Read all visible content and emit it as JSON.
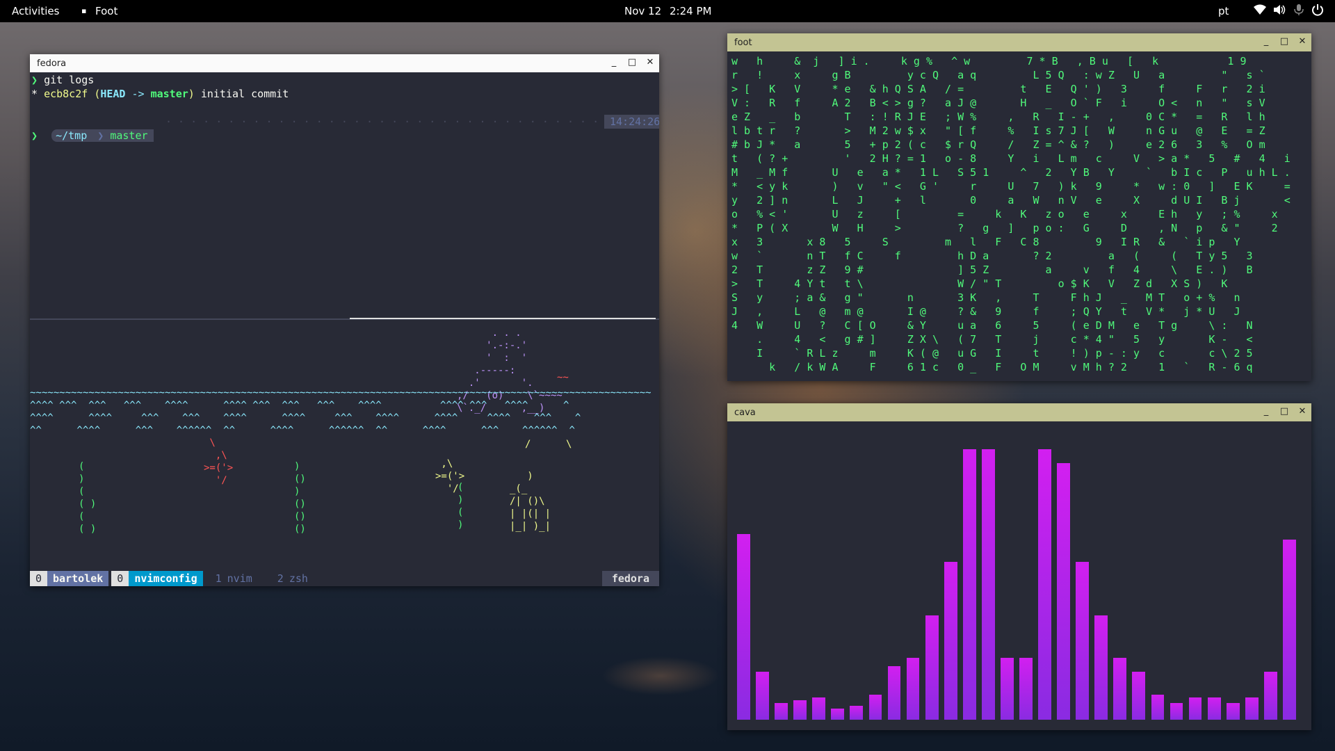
{
  "topbar": {
    "activities": "Activities",
    "app": "Foot",
    "date": "Nov 12",
    "time": "2:24 PM",
    "lang": "pt"
  },
  "win1": {
    "title": "fedora",
    "cmd_prompt": "❯",
    "cmd": "git logs",
    "log_star": "*",
    "log_hash": "ecb8c2f",
    "log_paren_open": "(",
    "log_head": "HEAD",
    "log_arrow": "->",
    "log_branch": "master",
    "log_paren_close": ")",
    "log_msg": "initial commit",
    "prompt_path": "~/tmp",
    "prompt_branch": "master",
    "prompt_time": "14:24:26",
    "prompt_char": "❯"
  },
  "tmux": {
    "session_num": "0",
    "user": "bartolek",
    "win_num": "0",
    "session": "nvimconfig",
    "w1_idx": "1",
    "w1_name": "nvim",
    "w2_idx": "2",
    "w2_name": "zsh",
    "host": "fedora"
  },
  "win2": {
    "title": "foot",
    "matrix": [
      "w   h     &  j   ] i .     k g %   ^ w         7 * B   , B u   [   k           1 9",
      "r   !     x     g B         y c Q   a q         L 5 Q   : w Z   U   a         \"   s `",
      "> [   K   V     * e   & h Q S A   / =         t   E   Q ' )   3     f     F   r   2 i",
      "V :   R   f     A 2   B < > g ?   a J @       H   _   O ` F   i     O <   n   \"   s V",
      "e Z   _   b       T   : ! R J E   ; W %     ,   R   I - +   ,     0 C *   =   R   l h",
      "l b t r   ?       >   M 2 w $ x   \" [ f     %   I s 7 J [   W     n G u   @   E   = Z",
      "# b J *   a       5   + p 2 ( c   $ r Q     /   Z = ^ & ?   )     e 2 6   3   %   O m",
      "t   ( ? +         '   2 H ? = 1   o - 8     Y   i   L m   c     V   > a *   5   #   4   i",
      "M   _ M f       U   e   a *   1 L   S 5 1     ^   2   Y B   Y     `   b I c   P   u h L .",
      "*   < y k       )   v   \" <   G '     r     U   7   ) k   9     *   w : 0   ]   E K     =",
      "y   2 ] n       L   J     +   l       0     a   W   n V   e     X     d U I   B j       <",
      "o   % < '       U   z     [         =     k   K   z o   e     x     E h   y   ; %     x",
      "*   P ( X       W   H     >         ?   g   ]   p o :   G     D     , N   p   & \"     2",
      "x   3       x 8   5     S         m   l   F   C 8         9   I R   &   ` i p   Y",
      "w   `       n T   f C     f         h D a       ? 2         a   (     (   T y 5   3",
      "2   T       z Z   9 #               ] 5 Z         a     v   f   4     \\   E . )   B",
      ">   T     4 Y t   t \\               W / \" T         o $ K   V   Z d   X S )   K",
      "S   y     ; a &   g \"       n       3 K   ,     T     F h J   _   M T   o + %   n",
      "J   ,     L   @   m @       I @     ? &   9     f     ; Q Y   t   V *   j * U   J",
      "4   W     U   ?   C [ O     & Y     u a   6     5     ( e D M   e   T g     \\ :   N",
      "    .     4   <   g # ]     Z X \\   ( 7   T     j     c * 4 \"   5   y       K -   <",
      "    I     ` R L z     m     K ( @   u G   I     t     ! ) p - : y   c       c \\ 2 5",
      "      k   / k W A     F     6 1 c   0 _   F   O M     v M h ? 2     1   `   R - 6 q"
    ]
  },
  "win3": {
    "title": "cava",
    "bars": [
      0.66,
      0.17,
      0.06,
      0.07,
      0.08,
      0.04,
      0.05,
      0.09,
      0.19,
      0.22,
      0.37,
      0.56,
      0.96,
      0.96,
      0.22,
      0.22,
      0.96,
      0.91,
      0.56,
      0.37,
      0.22,
      0.17,
      0.09,
      0.06,
      0.08,
      0.08,
      0.06,
      0.08,
      0.17,
      0.64
    ]
  },
  "aquarium": {
    "whale": [
      "      . . .",
      "     '.-:-.'",
      "     '  :  '",
      "   .-----:",
      "  .'       '.",
      ",/   (o)    \\`~~~~",
      "\\`._/      ,__)"
    ],
    "waves1": "~~~~~~~~~~~~~~~~~~~~~~~~~~~~~~~~~~~~~~~~~~~~~~~~~~~~~~~~~~~~~~~~~~~~~~~~~~~~~~~~~~~~~~~~~~~~~~~~~~~~~~~~~~",
    "waves2": "^^^^ ^^^  ^^^   ^^^    ^^^^      ^^^^ ^^^  ^^^   ^^^    ^^^^          ^^^^ ^^^   ^^^^      ^",
    "waves3": "^^^^      ^^^^     ^^^    ^^^    ^^^^      ^^^^     ^^^    ^^^^      ^^^^     ^^^^    ^^^    ^",
    "waves4": "^^      ^^^^      ^^^    ^^^^^^  ^^      ^^^^      ^^^^^^  ^^      ^^^^      ^^^    ^^^^^^  ^",
    "fish1": [
      " \\",
      "  ,\\",
      ">=('>",
      "  '/"
    ],
    "fish2": [
      " ,\\",
      ">=('>",
      "  '/"
    ],
    "squig": "~~",
    "weed": [
      "(",
      ")",
      "(",
      "( )",
      "(",
      "( )"
    ],
    "weed2": [
      ")",
      "()",
      ")",
      "()",
      "()",
      "()"
    ],
    "weed3": [
      "(",
      ")",
      "(",
      ")"
    ],
    "castle": [
      "   )",
      "_(_",
      "/| ()\\",
      "| |(| |",
      "|_| )_|"
    ],
    "spout": "/      \\"
  }
}
